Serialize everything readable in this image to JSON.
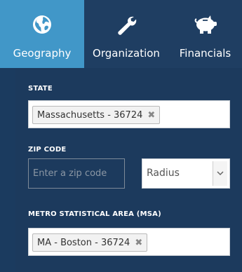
{
  "tabs": [
    {
      "label": "Geography",
      "icon": "globe-icon",
      "active": true
    },
    {
      "label": "Organization",
      "icon": "wrench-icon",
      "active": false
    },
    {
      "label": "Financials",
      "icon": "piggy-bank-icon",
      "active": false
    }
  ],
  "colors": {
    "active_tab": "#4197c8",
    "panel_bg": "#1c3a5d",
    "page_bg": "#1b3b5f"
  },
  "form": {
    "state": {
      "label": "STATE",
      "selected": "Massachusetts - 36724"
    },
    "zip": {
      "label": "ZIP CODE",
      "placeholder": "Enter a zip code",
      "value": ""
    },
    "radius": {
      "selected": "Radius"
    },
    "msa": {
      "label": "METRO STATISTICAL AREA (MSA)",
      "selected": "MA - Boston - 36724"
    }
  }
}
